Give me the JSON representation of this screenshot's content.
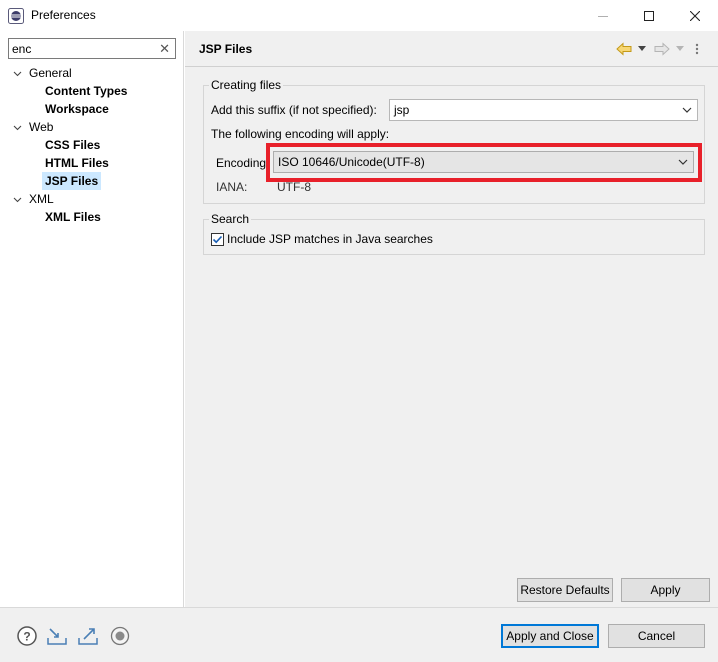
{
  "window": {
    "title": "Preferences"
  },
  "filter": {
    "value": "enc",
    "clear_glyph": "✕"
  },
  "tree": {
    "general": {
      "label": "General",
      "children": [
        "Content Types",
        "Workspace"
      ]
    },
    "web": {
      "label": "Web",
      "children": [
        "CSS Files",
        "HTML Files",
        "JSP Files"
      ]
    },
    "xml": {
      "label": "XML",
      "children": [
        "XML Files"
      ]
    },
    "selected": "JSP Files"
  },
  "page": {
    "title": "JSP Files"
  },
  "creating_files": {
    "legend": "Creating files",
    "suffix_label": "Add this suffix (if not specified):",
    "suffix_value": "jsp",
    "encoding_note": "The following encoding will apply:",
    "encoding_label": "Encoding",
    "encoding_value": "ISO 10646/Unicode(UTF-8)",
    "iana_label": "IANA:",
    "iana_value": "UTF-8"
  },
  "search": {
    "legend": "Search",
    "checkbox_label": "Include JSP matches in Java searches",
    "checked": true
  },
  "buttons": {
    "restore_defaults": "Restore Defaults",
    "apply": "Apply",
    "apply_and_close": "Apply and Close",
    "cancel": "Cancel"
  },
  "icons": {
    "help": "help-icon",
    "import": "import-icon",
    "export": "export-icon",
    "record": "record-icon",
    "back": "back-arrow-icon",
    "forward": "forward-arrow-icon"
  },
  "colors": {
    "highlight": "#e8202a",
    "selection": "#cce8ff",
    "default_button_border": "#0078d7"
  }
}
